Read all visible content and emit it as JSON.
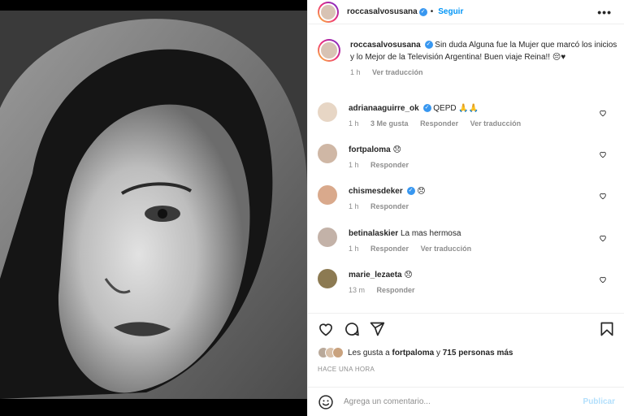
{
  "post": {
    "photo_alt": "",
    "author": "roccasalvosusana",
    "separator": "•",
    "follow_label": "Seguir",
    "more_label": "•••"
  },
  "caption": {
    "author": "roccasalvosusana",
    "text": "Sin duda Alguna fue la Mujer que marcó los inicios y lo Mejor de la Televisión Argentina! Buen viaje Reina!!",
    "emoji": "😔♥",
    "time": "1 h",
    "translate": "Ver traducción"
  },
  "comments": [
    {
      "user": "adrianaaguirre_ok",
      "verified": true,
      "text": "QEPD 🙏🙏",
      "time": "1 h",
      "likes": "3 Me gusta",
      "reply": "Responder",
      "translate": "Ver traducción",
      "avatar_color": "#e7d6c5"
    },
    {
      "user": "fortpaloma",
      "verified": false,
      "text": "😞",
      "time": "1 h",
      "likes": "",
      "reply": "Responder",
      "translate": "",
      "avatar_color": "#cfb7a5"
    },
    {
      "user": "chismesdeker",
      "verified": true,
      "text": "😞",
      "time": "1 h",
      "likes": "",
      "reply": "Responder",
      "translate": "",
      "avatar_color": "#d9a98c"
    },
    {
      "user": "betinalaskier",
      "verified": false,
      "text": "La mas hermosa",
      "time": "1 h",
      "likes": "",
      "reply": "Responder",
      "translate": "Ver traducción",
      "avatar_color": "#c3b2a8"
    },
    {
      "user": "marie_lezaeta",
      "verified": false,
      "text": "😞",
      "time": "13 m",
      "likes": "",
      "reply": "Responder",
      "translate": "",
      "avatar_color": "#8c7a52"
    }
  ],
  "likes": {
    "prefix": "Les gusta a",
    "user": "fortpaloma",
    "and": "y",
    "others": "715 personas más",
    "avatar_colors": [
      "#b9a99a",
      "#d8c0a9",
      "#c9a27e"
    ]
  },
  "timestamp": "HACE UNA HORA",
  "compose": {
    "placeholder": "Agrega un comentario...",
    "publish": "Publicar"
  },
  "icons": {
    "heart": "heart-icon",
    "comment": "comment-icon",
    "share": "share-icon",
    "save": "bookmark-icon",
    "emoji": "emoji-icon",
    "verified": "verified-badge-icon"
  },
  "colors": {
    "link": "#0095f6",
    "verified": "#3897f0",
    "muted": "#8e8e8e"
  }
}
